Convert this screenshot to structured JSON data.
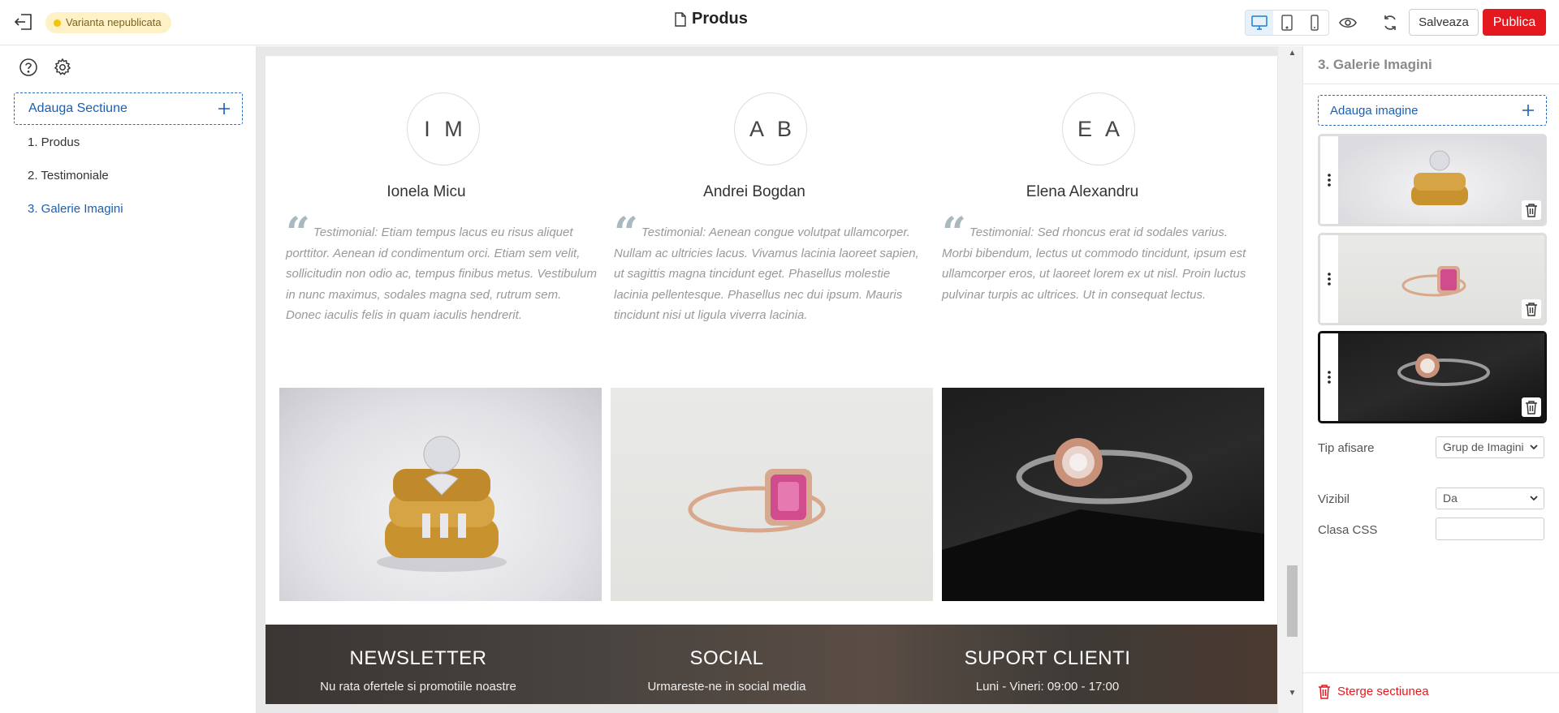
{
  "topbar": {
    "status_badge": "Varianta nepublicata",
    "title": "Produs",
    "save_label": "Salveaza",
    "publish_label": "Publica"
  },
  "left_panel": {
    "add_section_label": "Adauga Sectiune",
    "sections": [
      {
        "label": "1. Produs",
        "active": false
      },
      {
        "label": "2. Testimoniale",
        "active": false
      },
      {
        "label": "3. Galerie Imagini",
        "active": true
      }
    ]
  },
  "testimonials": [
    {
      "initials": "I M",
      "name": "Ionela Micu",
      "text": "Testimonial: Etiam tempus lacus eu risus aliquet porttitor. Aenean id condimentum orci. Etiam sem velit, sollicitudin non odio ac, tempus finibus metus. Vestibulum in nunc maximus, sodales magna sed, rutrum sem. Donec iaculis felis in quam iaculis hendrerit."
    },
    {
      "initials": "A B",
      "name": "Andrei Bogdan",
      "text": "Testimonial: Aenean congue volutpat ullamcorper. Nullam ac ultricies lacus. Vivamus lacinia laoreet sapien, ut sagittis magna tincidunt eget. Phasellus molestie lacinia pellentesque. Phasellus nec dui ipsum. Mauris tincidunt nisi ut ligula viverra lacinia."
    },
    {
      "initials": "E A",
      "name": "Elena Alexandru",
      "text": "Testimonial: Sed rhoncus erat id sodales varius. Morbi bibendum, lectus ut commodo tincidunt, ipsum est ullamcorper eros, ut laoreet lorem ex ut nisl. Proin luctus pulvinar turpis ac ultrices. Ut in consequat lectus."
    }
  ],
  "footer": {
    "newsletter_title": "NEWSLETTER",
    "newsletter_sub": "Nu rata ofertele si promotiile noastre",
    "social_title": "SOCIAL",
    "social_sub": "Urmareste-ne in social media",
    "support_title": "SUPORT CLIENTI",
    "support_sub": "Luni - Vineri: 09:00 - 17:00"
  },
  "right_panel": {
    "title": "3. Galerie Imagini",
    "add_image_label": "Adauga imagine",
    "display_type_label": "Tip afisare",
    "display_type_value": "Grup de Imagini",
    "visible_label": "Vizibil",
    "visible_value": "Da",
    "css_class_label": "Clasa CSS",
    "css_class_value": "",
    "delete_label": "Sterge sectiunea"
  },
  "colors": {
    "accent_blue": "#1a5fb4",
    "publish_red": "#e3191f",
    "badge_bg": "#fdf1c5"
  }
}
